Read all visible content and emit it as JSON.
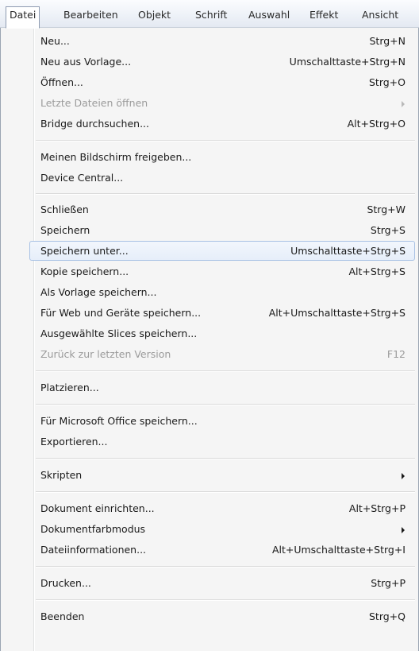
{
  "menubar": {
    "items": [
      "Datei",
      "Bearbeiten",
      "Objekt",
      "Schrift",
      "Auswahl",
      "Effekt",
      "Ansicht"
    ],
    "active_index": 0
  },
  "menu": {
    "items": [
      {
        "label": "Neu...",
        "shortcut": "Strg+N"
      },
      {
        "label": "Neu aus Vorlage...",
        "shortcut": "Umschalttaste+Strg+N"
      },
      {
        "label": "Öffnen...",
        "shortcut": "Strg+O"
      },
      {
        "label": "Letzte Dateien öffnen",
        "submenu": true,
        "disabled": true
      },
      {
        "label": "Bridge durchsuchen...",
        "shortcut": "Alt+Strg+O"
      },
      {
        "label": "Meinen Bildschirm freigeben..."
      },
      {
        "label": "Device Central..."
      },
      {
        "label": "Schließen",
        "shortcut": "Strg+W"
      },
      {
        "label": "Speichern",
        "shortcut": "Strg+S"
      },
      {
        "label": "Speichern unter...",
        "shortcut": "Umschalttaste+Strg+S",
        "highlighted": true
      },
      {
        "label": "Kopie speichern...",
        "shortcut": "Alt+Strg+S"
      },
      {
        "label": "Als Vorlage speichern..."
      },
      {
        "label": "Für Web und Geräte speichern...",
        "shortcut": "Alt+Umschalttaste+Strg+S"
      },
      {
        "label": "Ausgewählte Slices speichern..."
      },
      {
        "label": "Zurück zur letzten Version",
        "shortcut": "F12",
        "disabled": true
      },
      {
        "label": "Platzieren..."
      },
      {
        "label": "Für Microsoft Office speichern..."
      },
      {
        "label": "Exportieren..."
      },
      {
        "label": "Skripten",
        "submenu": true
      },
      {
        "label": "Dokument einrichten...",
        "shortcut": "Alt+Strg+P"
      },
      {
        "label": "Dokumentfarbmodus",
        "submenu": true
      },
      {
        "label": "Dateiinformationen...",
        "shortcut": "Alt+Umschalttaste+Strg+I"
      },
      {
        "label": "Drucken...",
        "shortcut": "Strg+P"
      },
      {
        "label": "Beenden",
        "shortcut": "Strg+Q"
      }
    ]
  }
}
